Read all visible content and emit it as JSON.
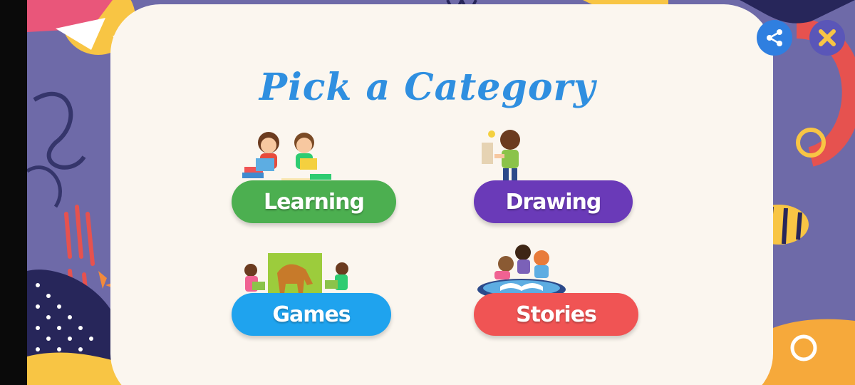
{
  "screen": {
    "title": "Pick a Category"
  },
  "categories": [
    {
      "label": "Learning",
      "color": "#4caf50",
      "art_icon": "kids-reading-icon"
    },
    {
      "label": "Drawing",
      "color": "#6a3ab8",
      "art_icon": "boy-drawing-icon"
    },
    {
      "label": "Games",
      "color": "#1fa3ee",
      "art_icon": "horse-puzzle-icon"
    },
    {
      "label": "Stories",
      "color": "#f05454",
      "art_icon": "kids-storybook-icon"
    }
  ],
  "top_buttons": {
    "share_icon": "share-icon",
    "close_icon": "close-icon"
  },
  "colors": {
    "background": "#6e6aa8",
    "board": "#fbf6ef",
    "title": "#2f8fe0"
  }
}
